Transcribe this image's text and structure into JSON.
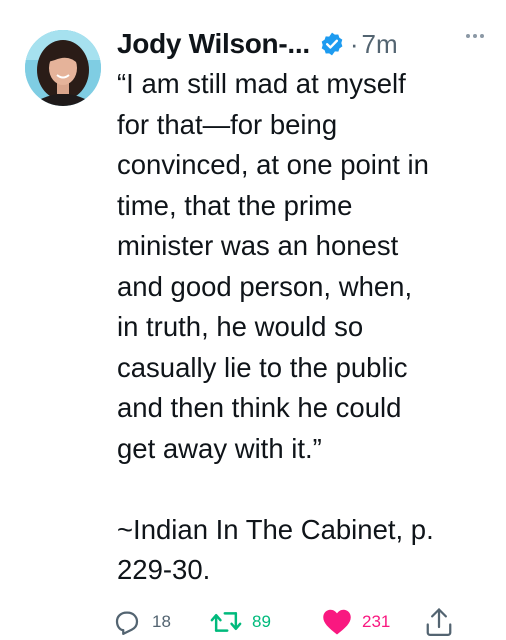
{
  "tweet": {
    "author_name": "Jody Wilson-...",
    "separator": "·",
    "time_ago": "7m",
    "text": "“I am still mad at myself\nfor that—for being\nconvinced, at one point in\ntime, that the prime\nminister was an honest\nand good person, when,\nin truth, he would so\ncasually lie to the public\nand then think he could\nget away with it.”\n\n~Indian In The Cabinet, p.\n229-30."
  },
  "actions": {
    "reply_count": "18",
    "retweet_count": "89",
    "like_count": "231"
  },
  "icons": {
    "verified": "verified-badge-icon",
    "more": "more-icon",
    "reply": "reply-icon",
    "retweet": "retweet-icon",
    "like": "heart-icon",
    "share": "share-icon"
  },
  "colors": {
    "verified_blue": "#1d9bf0",
    "retweet_green": "#00ba7c",
    "like_pink": "#f91880",
    "secondary_gray": "#536471"
  }
}
